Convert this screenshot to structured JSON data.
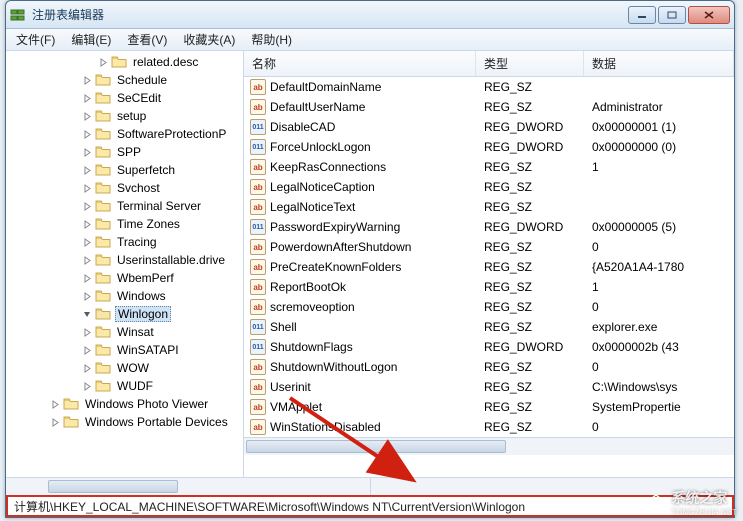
{
  "window": {
    "title": "注册表编辑器"
  },
  "menu": {
    "file": "文件(F)",
    "edit": "编辑(E)",
    "view": "查看(V)",
    "fav": "收藏夹(A)",
    "help": "帮助(H)"
  },
  "tree_indent_base": 76,
  "tree": [
    {
      "label": "related.desc",
      "indent": 92
    },
    {
      "label": "Schedule",
      "indent": 76
    },
    {
      "label": "SeCEdit",
      "indent": 76
    },
    {
      "label": "setup",
      "indent": 76
    },
    {
      "label": "SoftwareProtectionP",
      "indent": 76
    },
    {
      "label": "SPP",
      "indent": 76
    },
    {
      "label": "Superfetch",
      "indent": 76
    },
    {
      "label": "Svchost",
      "indent": 76
    },
    {
      "label": "Terminal Server",
      "indent": 76
    },
    {
      "label": "Time Zones",
      "indent": 76
    },
    {
      "label": "Tracing",
      "indent": 76
    },
    {
      "label": "Userinstallable.drive",
      "indent": 76
    },
    {
      "label": "WbemPerf",
      "indent": 76
    },
    {
      "label": "Windows",
      "indent": 76
    },
    {
      "label": "Winlogon",
      "indent": 76,
      "selected": true,
      "open": true
    },
    {
      "label": "Winsat",
      "indent": 76
    },
    {
      "label": "WinSATAPI",
      "indent": 76
    },
    {
      "label": "WOW",
      "indent": 76
    },
    {
      "label": "WUDF",
      "indent": 76
    },
    {
      "label": "Windows Photo Viewer",
      "indent": 44
    },
    {
      "label": "Windows Portable Devices",
      "indent": 44
    }
  ],
  "headers": {
    "name": "名称",
    "type": "类型",
    "data": "数据"
  },
  "values": [
    {
      "icon": "sz",
      "name": "DefaultDomainName",
      "type": "REG_SZ",
      "data": ""
    },
    {
      "icon": "sz",
      "name": "DefaultUserName",
      "type": "REG_SZ",
      "data": "Administrator"
    },
    {
      "icon": "bin",
      "name": "DisableCAD",
      "type": "REG_DWORD",
      "data": "0x00000001 (1)"
    },
    {
      "icon": "bin",
      "name": "ForceUnlockLogon",
      "type": "REG_DWORD",
      "data": "0x00000000 (0)"
    },
    {
      "icon": "sz",
      "name": "KeepRasConnections",
      "type": "REG_SZ",
      "data": "1"
    },
    {
      "icon": "sz",
      "name": "LegalNoticeCaption",
      "type": "REG_SZ",
      "data": ""
    },
    {
      "icon": "sz",
      "name": "LegalNoticeText",
      "type": "REG_SZ",
      "data": ""
    },
    {
      "icon": "bin",
      "name": "PasswordExpiryWarning",
      "type": "REG_DWORD",
      "data": "0x00000005 (5)"
    },
    {
      "icon": "sz",
      "name": "PowerdownAfterShutdown",
      "type": "REG_SZ",
      "data": "0"
    },
    {
      "icon": "sz",
      "name": "PreCreateKnownFolders",
      "type": "REG_SZ",
      "data": "{A520A1A4-1780"
    },
    {
      "icon": "sz",
      "name": "ReportBootOk",
      "type": "REG_SZ",
      "data": "1"
    },
    {
      "icon": "sz",
      "name": "scremoveoption",
      "type": "REG_SZ",
      "data": "0"
    },
    {
      "icon": "bin",
      "name": "Shell",
      "type": "REG_SZ",
      "data": "explorer.exe"
    },
    {
      "icon": "bin",
      "name": "ShutdownFlags",
      "type": "REG_DWORD",
      "data": "0x0000002b (43"
    },
    {
      "icon": "sz",
      "name": "ShutdownWithoutLogon",
      "type": "REG_SZ",
      "data": "0"
    },
    {
      "icon": "sz",
      "name": "Userinit",
      "type": "REG_SZ",
      "data": "C:\\Windows\\sys"
    },
    {
      "icon": "sz",
      "name": "VMApplet",
      "type": "REG_SZ",
      "data": "SystemPropertie"
    },
    {
      "icon": "sz",
      "name": "WinStationsDisabled",
      "type": "REG_SZ",
      "data": "0"
    }
  ],
  "status": "计算机\\HKEY_LOCAL_MACHINE\\SOFTWARE\\Microsoft\\Windows NT\\CurrentVersion\\Winlogon",
  "watermark": {
    "text1": "系统之家",
    "text2": "TONGZHIJIA.NET"
  }
}
